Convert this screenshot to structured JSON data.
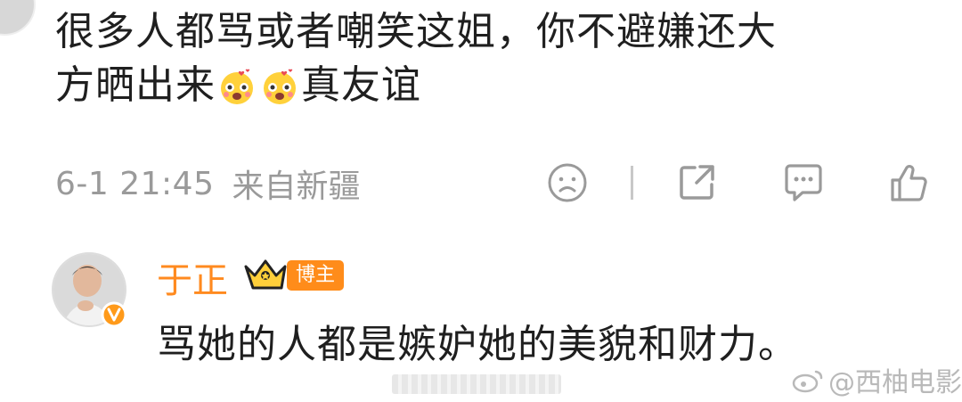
{
  "comment": {
    "line1": "很多人都骂或者嘲笑这姐，你不避嫌还大",
    "line2_prefix": "方晒出来",
    "line2_suffix": "真友谊",
    "emoji_names": [
      "blush-heart-emoji",
      "blush-heart-emoji"
    ]
  },
  "meta": {
    "time": "6-1 21:45",
    "location": "来自新疆",
    "icons": [
      "dislike-face-icon",
      "share-icon",
      "comment-icon",
      "like-thumb-icon"
    ]
  },
  "reply": {
    "name": "于正",
    "badge": "博主",
    "text": "骂她的人都是嫉妒她的美貌和财力。"
  },
  "watermark": {
    "text": "@西柚电影"
  },
  "colors": {
    "accent_orange": "#ff8a1f",
    "meta_gray": "#9a9a9a",
    "text": "#1f1f1f"
  }
}
